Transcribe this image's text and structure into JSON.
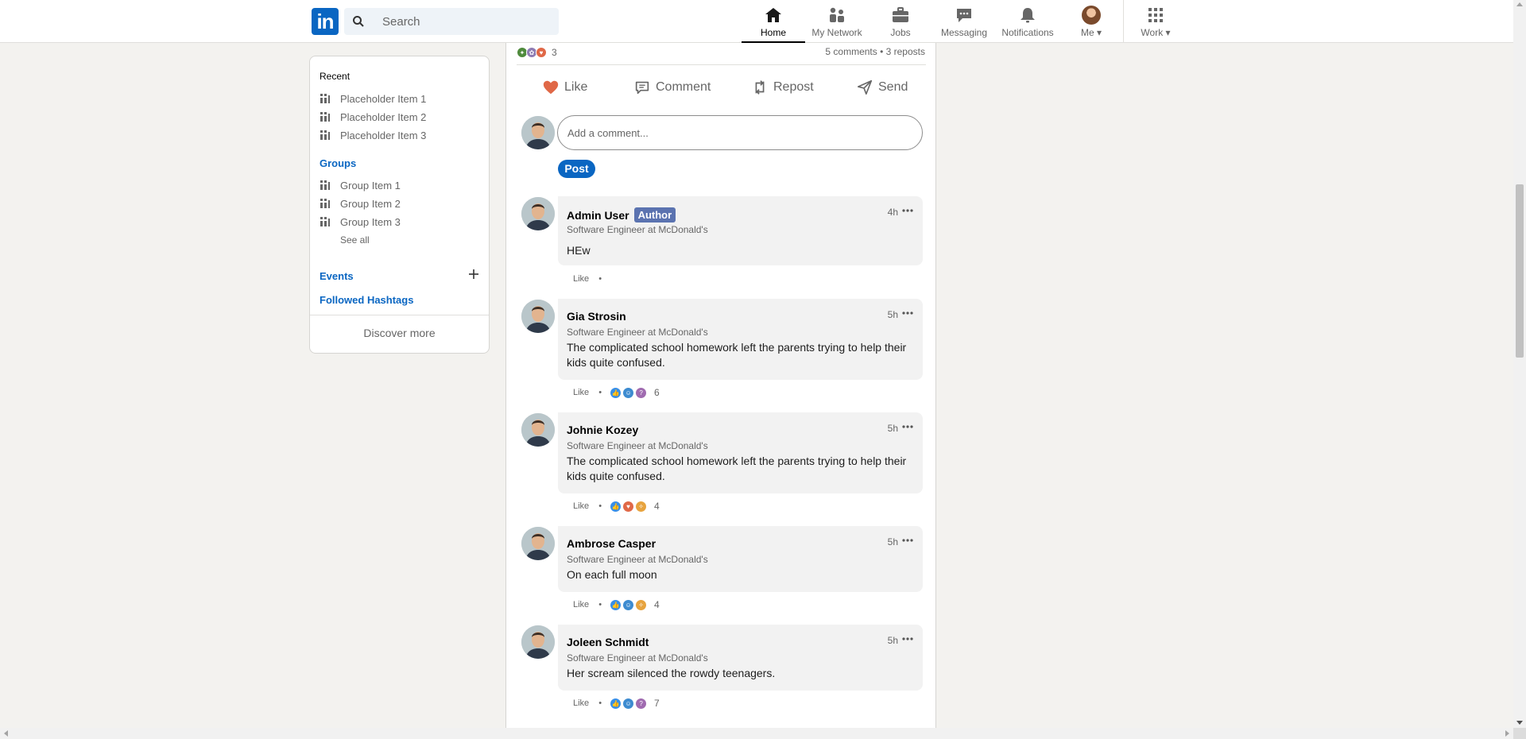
{
  "nav": {
    "logo": "in",
    "search_placeholder": "Search",
    "items": [
      {
        "label": "Home",
        "icon": "home-icon"
      },
      {
        "label": "My Network",
        "icon": "network-icon"
      },
      {
        "label": "Jobs",
        "icon": "briefcase-icon"
      },
      {
        "label": "Messaging",
        "icon": "chat-icon"
      },
      {
        "label": "Notifications",
        "icon": "bell-icon"
      },
      {
        "label": "Me",
        "icon": "avatar"
      },
      {
        "label": "Work",
        "icon": "grid-icon"
      }
    ],
    "accent": "#0a66c2"
  },
  "sidebar": {
    "recent_heading": "Recent",
    "recent": [
      "Placeholder Item 1",
      "Placeholder Item 2",
      "Placeholder Item 3"
    ],
    "groups_heading": "Groups",
    "groups": [
      "Group Item 1",
      "Group Item 2",
      "Group Item 3"
    ],
    "see_all": "See all",
    "events": "Events",
    "hashtags": "Followed Hashtags",
    "discover": "Discover more"
  },
  "post": {
    "reaction_count": "3",
    "stats": "5 comments • 3 reposts",
    "actions": [
      "Like",
      "Comment",
      "Repost",
      "Send"
    ],
    "comment_placeholder": "Add a comment...",
    "post_button": "Post"
  },
  "comments": [
    {
      "name": "Admin User",
      "badge": "Author",
      "title": "Software Engineer at McDonald's",
      "time": "4h",
      "text": "HEw",
      "like": "Like",
      "count": ""
    },
    {
      "name": "Gia Strosin",
      "title": "Software Engineer at McDonald's",
      "time": "5h",
      "text": "The complicated school homework left the parents trying to help their kids quite confused.",
      "like": "Like",
      "count": "6"
    },
    {
      "name": "Johnie Kozey",
      "title": "Software Engineer at McDonald's",
      "time": "5h",
      "text": "The complicated school homework left the parents trying to help their kids quite confused.",
      "like": "Like",
      "count": "4"
    },
    {
      "name": "Ambrose Casper",
      "title": "Software Engineer at McDonald's",
      "time": "5h",
      "text": "On each full moon",
      "like": "Like",
      "count": "4"
    },
    {
      "name": "Joleen Schmidt",
      "title": "Software Engineer at McDonald's",
      "time": "5h",
      "text": "Her scream silenced the rowdy teenagers.",
      "like": "Like",
      "count": "7"
    }
  ]
}
